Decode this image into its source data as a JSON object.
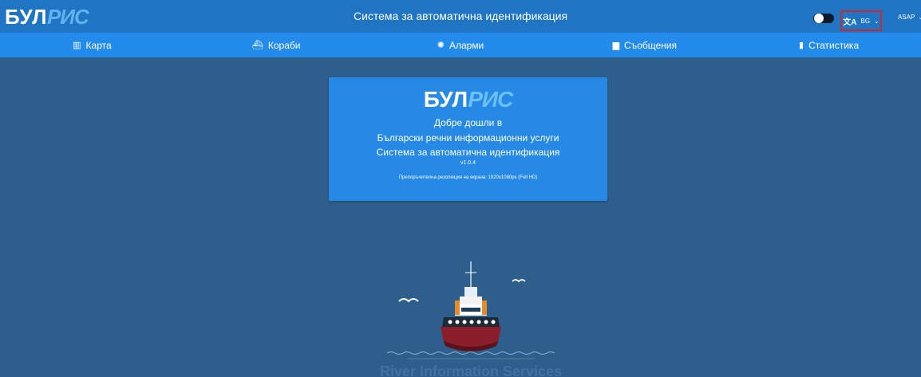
{
  "header": {
    "logo_part1": "БУЛ",
    "logo_part2": "РИС",
    "title": "Система за автоматична идентификация",
    "language": "BG",
    "user": "ASAP"
  },
  "nav": [
    {
      "label": "Карта",
      "icon": "map-icon"
    },
    {
      "label": "Кораби",
      "icon": "ship-icon"
    },
    {
      "label": "Аларми",
      "icon": "alarm-icon"
    },
    {
      "label": "Съобщения",
      "icon": "messages-icon"
    },
    {
      "label": "Статистика",
      "icon": "stats-icon"
    }
  ],
  "welcome": {
    "logo_part1": "БУЛ",
    "logo_part2": "РИС",
    "line1": "Добре дошли в",
    "line2": "Български речни информационни услуги",
    "line3": "Система за автоматична идентификация",
    "version": "v1.0.4",
    "resolution": "Препоръчителна резолюция на екрана: 1920x1080px (Full HD)"
  },
  "footer": {
    "text": "River Information Services"
  },
  "colors": {
    "background": "#2e5f8c",
    "topbar": "#1f74c4",
    "navbar": "#238bec",
    "card": "#2589e5",
    "highlight": "#d0262b"
  }
}
